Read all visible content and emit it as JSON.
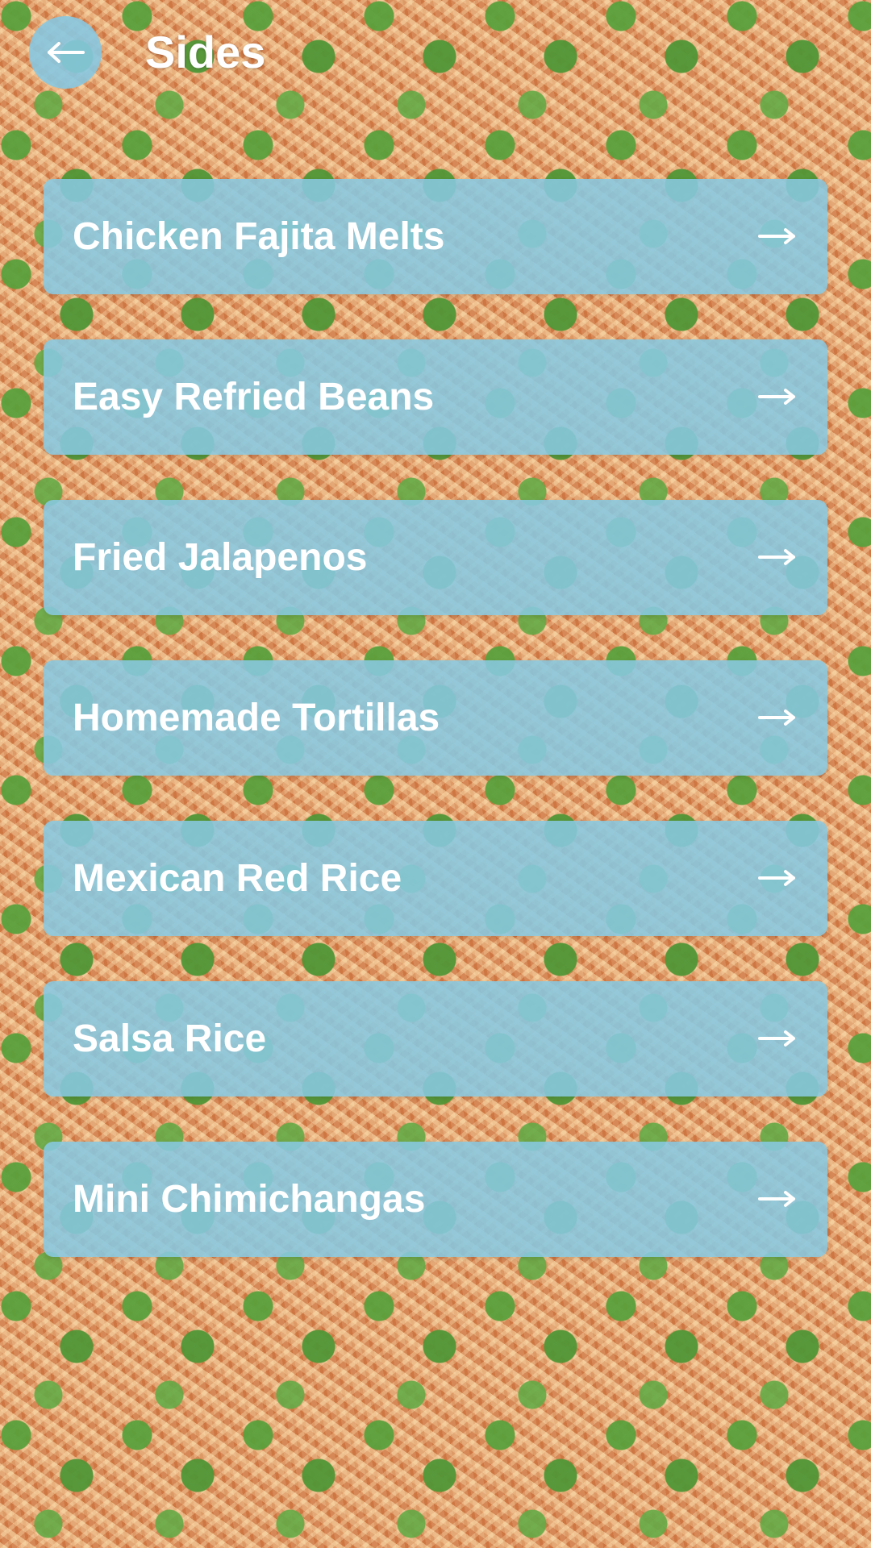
{
  "header": {
    "title": "Sides",
    "back_icon": "arrow-left-icon"
  },
  "items": [
    {
      "label": "Chicken Fajita Melts",
      "icon": "arrow-right-icon"
    },
    {
      "label": "Easy Refried Beans",
      "icon": "arrow-right-icon"
    },
    {
      "label": "Fried Jalapenos",
      "icon": "arrow-right-icon"
    },
    {
      "label": "Homemade Tortillas",
      "icon": "arrow-right-icon"
    },
    {
      "label": "Mexican Red Rice",
      "icon": "arrow-right-icon"
    },
    {
      "label": "Salsa Rice",
      "icon": "arrow-right-icon"
    },
    {
      "label": "Mini Chimichangas",
      "icon": "arrow-right-icon"
    }
  ],
  "colors": {
    "card": "#87C8E1",
    "text": "#FFFFFF"
  }
}
